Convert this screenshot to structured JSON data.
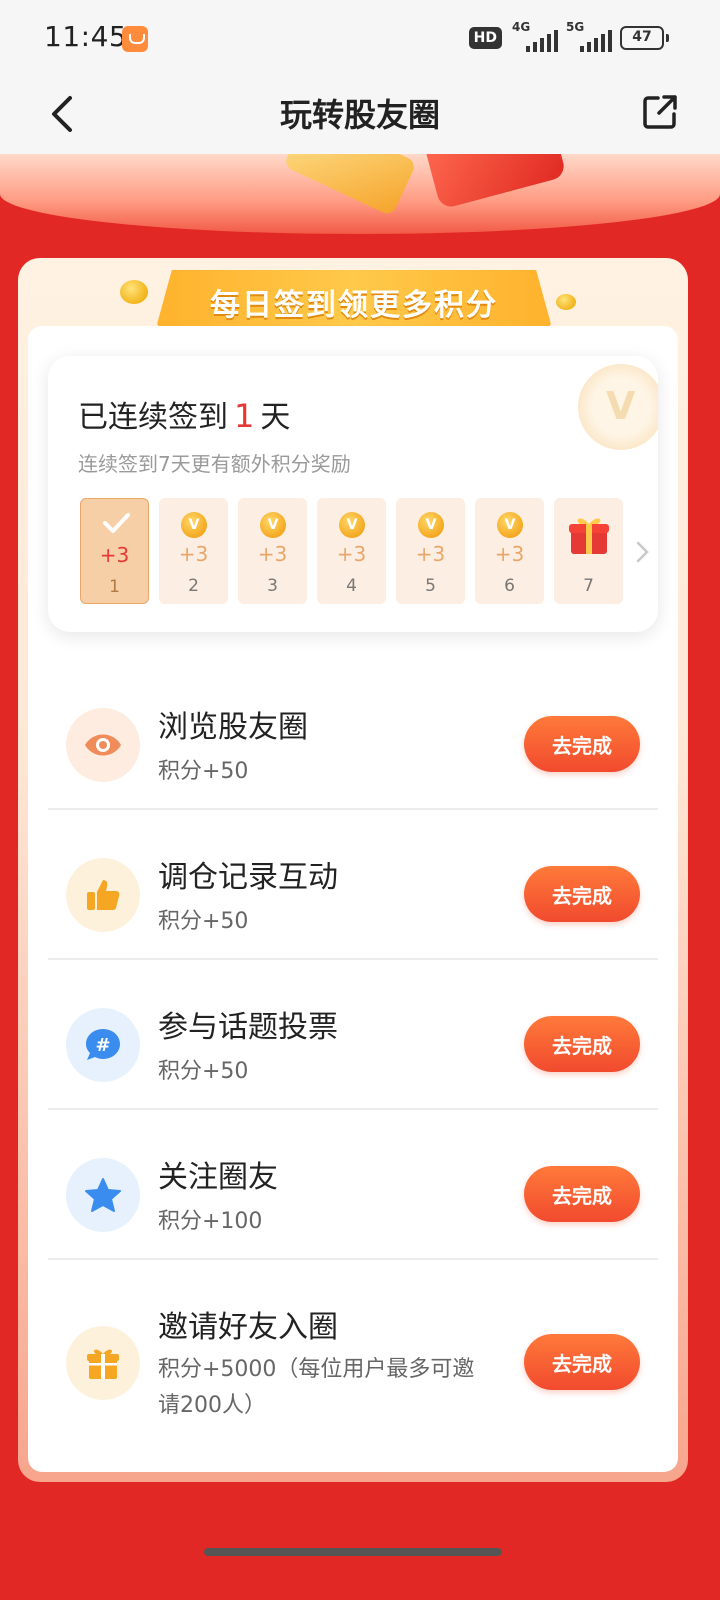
{
  "status_bar": {
    "time": "11:45",
    "hd": "HD",
    "signal_1": "4G",
    "signal_2": "5G",
    "battery": "47"
  },
  "nav": {
    "title": "玩转股友圈",
    "back_icon": "chevron-left-icon",
    "share_icon": "external-share-icon"
  },
  "header": {
    "title": "每日签到领更多积分"
  },
  "checkin": {
    "prefix": "已连续签到",
    "days": "1",
    "suffix": "天",
    "subtitle": "连续签到7天更有额外积分奖励",
    "items": [
      {
        "reward": "+3",
        "day": "1",
        "state": "done"
      },
      {
        "reward": "+3",
        "day": "2",
        "state": "pending"
      },
      {
        "reward": "+3",
        "day": "3",
        "state": "pending"
      },
      {
        "reward": "+3",
        "day": "4",
        "state": "pending"
      },
      {
        "reward": "+3",
        "day": "5",
        "state": "pending"
      },
      {
        "reward": "+3",
        "day": "6",
        "state": "pending"
      },
      {
        "reward": "",
        "day": "7",
        "state": "gift"
      }
    ]
  },
  "tasks": [
    {
      "title": "浏览股友圈",
      "reward": "积分+50",
      "button": "去完成",
      "icon": "eye-icon"
    },
    {
      "title": "调仓记录互动",
      "reward": "积分+50",
      "button": "去完成",
      "icon": "thumbs-up-icon"
    },
    {
      "title": "参与话题投票",
      "reward": "积分+50",
      "button": "去完成",
      "icon": "hashtag-chat-icon"
    },
    {
      "title": "关注圈友",
      "reward": "积分+100",
      "button": "去完成",
      "icon": "star-icon"
    },
    {
      "title": "邀请好友入圈",
      "reward_line1": "积分+5000（每位用户最多可邀",
      "reward_line2": "请200人）",
      "button": "去完成",
      "icon": "gift-icon"
    }
  ],
  "colors": {
    "brand_red": "#e22824",
    "button_orange": "#f14a2e",
    "highlight_red": "#e53935"
  }
}
